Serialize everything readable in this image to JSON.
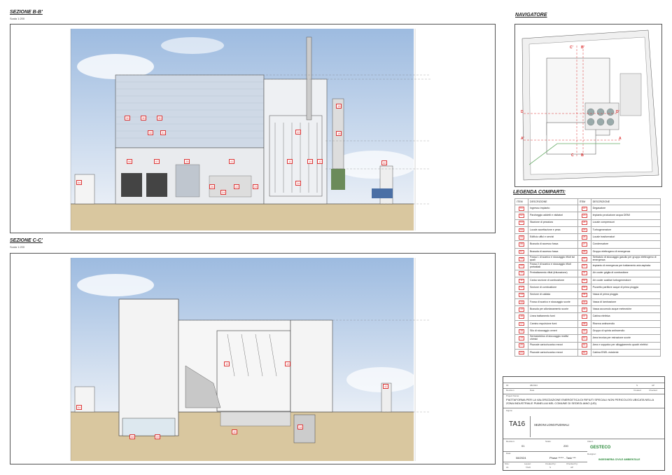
{
  "section_bb": {
    "title": "SEZIONE B-B'",
    "scale": "Scala 1:200"
  },
  "section_cc": {
    "title": "SEZIONE C-C'",
    "scale": "Scala 1:200"
  },
  "navigator": {
    "title": "NAVIGATORE",
    "labels": [
      "C'",
      "B'",
      "D",
      "D'",
      "A'",
      "A",
      "C",
      "B"
    ]
  },
  "legend": {
    "title": "LEGENDA COMPARTI:",
    "col_item": "ITEM",
    "col_desc": "DESCRIZIONE",
    "left": [
      [
        "01",
        "Ingresso impianto"
      ],
      [
        "02",
        "Parcheggio addetti e visitatori"
      ],
      [
        "03",
        "Stazione di pesatura"
      ],
      [
        "04",
        "Locale accettazione e pesa"
      ],
      [
        "05",
        "Edificio uffici e servizi"
      ],
      [
        "06",
        "Bussola di accesso fossa"
      ],
      [
        "07",
        "Bussola di accesso fossa"
      ],
      [
        "08",
        "Fossa 1 di scarico e stoccaggio rifiuti tal quali"
      ],
      [
        "09",
        "Fossa 2 di scarico e stoccaggio rifiuti pretrattati"
      ],
      [
        "10",
        "Pretrattamento rifiuti (triturazione)"
      ],
      [
        "11",
        "Carico sezione di combustione"
      ],
      [
        "12",
        "Sezione di combustione"
      ],
      [
        "13",
        "Sezione di caldaia"
      ],
      [
        "14",
        "Fossa di scarico e stoccaggio scorie"
      ],
      [
        "15",
        "Bussola per allontanamento scorie"
      ],
      [
        "16",
        "Linea trattamento fumi"
      ],
      [
        "17",
        "Camino espulsione fumi"
      ],
      [
        "18",
        "Silo di stoccaggio ceneri"
      ],
      [
        "19",
        "Serbatoi/silos di stoccaggio reattivi chimici"
      ],
      [
        "20",
        "Piazzale carico/scarico mezzi"
      ],
      [
        "21",
        "Piazzale carico/scarico mezzi"
      ]
    ],
    "right": [
      [
        "22",
        "Degasatore"
      ],
      [
        "23",
        "Impianto produzione acqua DEMI"
      ],
      [
        "24",
        "Locale compressori"
      ],
      [
        "25",
        "Turbogeneratore"
      ],
      [
        "26",
        "Locale trasformatori"
      ],
      [
        "27",
        "Condensatore"
      ],
      [
        "28",
        "Gruppo elettrogeno di emergenza"
      ],
      [
        "29",
        "Serbatoio di stoccaggio gasolio per gruppo elettrogeno di emergenza"
      ],
      [
        "30",
        "Impianto di emergenza per trattamento aria aspirata"
      ],
      [
        "31",
        "Air cooler griglia di combustione"
      ],
      [
        "32",
        "Air cooler ausiliari turbogeneratore"
      ],
      [
        "33",
        "Pozzetto partitore acque di prima pioggia"
      ],
      [
        "34",
        "Vasca di prima pioggia"
      ],
      [
        "35",
        "Vasca di laminazione"
      ],
      [
        "36",
        "Vasca accumulo acque meteoriche"
      ],
      [
        "37",
        "Cabina elettrica"
      ],
      [
        "38",
        "Riserva antincendio"
      ],
      [
        "39",
        "Gruppo di spinta antincendio"
      ],
      [
        "40",
        "Area tecnica per estrazione scorie"
      ],
      [
        "41",
        "Area e soppalco per alloggiamento quadri elettrici"
      ],
      [
        "42",
        "Cabina ENEL esistente"
      ]
    ]
  },
  "titleblock": {
    "rev": "00",
    "rev_date": "08/2024",
    "rev_by": "S",
    "rev_chk": "AP",
    "rev_h1": "Revision",
    "rev_h2": "Date",
    "rev_h3": "Created",
    "rev_h4": "Checked",
    "project_label": "Project Name:",
    "project": "PIATTAFORMA PER LA VALORIZZAZIONE ENERGETICA DI RIFIUTI SPECIALI NON PERICOLOSI UBICATA NELLA ZONA INDUSTRIALE PIANELLIA NEL COMUNE DI SEDEGLIANO (UD)",
    "figure_label": "Figure:",
    "code": "TA16",
    "figure_title": "SEZIONI LONGITUDINALI",
    "revision_label": "Revision:",
    "revision": "01",
    "scale_label": "Scale:",
    "scale": "200",
    "client_label": "Client:",
    "date_label": "Date:",
    "date": "08/2024",
    "phase": "Phase ***** - Task ***",
    "designer_label": "Designer:",
    "size_label": "Size:",
    "size": "A1",
    "layout_label": "Layout:",
    "layout": "TA16",
    "created_label": "Created by:",
    "created": "S",
    "checked_label": "Checked by:",
    "checked": "AP",
    "client_logo": "GESTECO",
    "designer_logo": "INGEGNERIA CIVILE AMBIENTALE"
  },
  "section_bb_tags": [
    "30",
    "30",
    "30",
    "32",
    "31",
    "06",
    "07",
    "25",
    "41",
    "15",
    "18",
    "13",
    "11",
    "10",
    "12",
    "04",
    "26",
    "24",
    "22",
    "23",
    "14",
    "42",
    "20",
    "19"
  ],
  "section_cc_tags": [
    "12",
    "13",
    "04",
    "42",
    "08",
    "09",
    "40",
    "14"
  ],
  "colors": {
    "tag_red": "#d33",
    "sky": "#b9d0e8",
    "ground": "#c8b58c"
  }
}
